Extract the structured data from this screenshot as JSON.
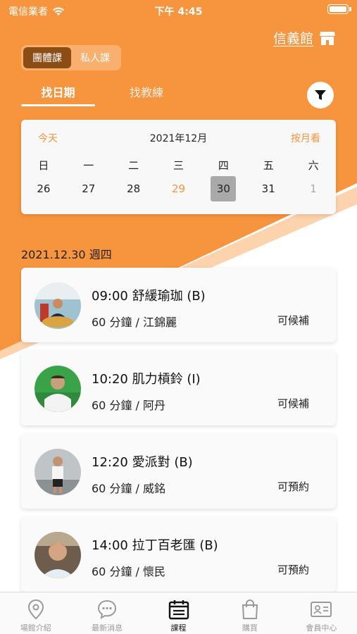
{
  "status_bar": {
    "carrier": "電信業者",
    "time": "下午 4:45"
  },
  "branch": {
    "name": "信義館",
    "icon": "store-icon"
  },
  "class_type": {
    "options": [
      "團體課",
      "私人課"
    ],
    "selected": "團體課"
  },
  "search_tabs": {
    "by_date": "找日期",
    "by_coach": "找教練",
    "selected": "找日期"
  },
  "calendar": {
    "today_label": "今天",
    "month": "2021年12月",
    "month_view_label": "按月看",
    "weekdays": [
      "日",
      "一",
      "二",
      "三",
      "四",
      "五",
      "六"
    ],
    "dates": [
      "26",
      "27",
      "28",
      "29",
      "30",
      "31",
      "1"
    ],
    "today": "29",
    "selected": "30"
  },
  "list_date": "2021.12.30 週四",
  "classes": [
    {
      "time_name": "09:00 舒緩瑜珈 (B)",
      "duration_coach": "60 分鐘 / 江錦麗",
      "status": "可候補"
    },
    {
      "time_name": "10:20 肌力槓鈴 (I)",
      "duration_coach": "60 分鐘 / 阿丹",
      "status": "可候補"
    },
    {
      "time_name": "12:20 愛派對 (B)",
      "duration_coach": "60 分鐘 / 威銘",
      "status": "可預約"
    },
    {
      "time_name": "14:00 拉丁百老匯 (B)",
      "duration_coach": "60 分鐘 / 懷民",
      "status": "可預約"
    }
  ],
  "bottom_nav": [
    {
      "label": "場館介紹",
      "icon": "location-pin-icon"
    },
    {
      "label": "最新消息",
      "icon": "chat-bubble-icon"
    },
    {
      "label": "課程",
      "icon": "calendar-icon",
      "active": true
    },
    {
      "label": "購買",
      "icon": "shopping-bag-icon"
    },
    {
      "label": "會員中心",
      "icon": "member-card-icon"
    }
  ],
  "colors": {
    "primary": "#f7943e",
    "toggle_active": "#8b4d14",
    "selected_date": "#a9a9a9"
  }
}
